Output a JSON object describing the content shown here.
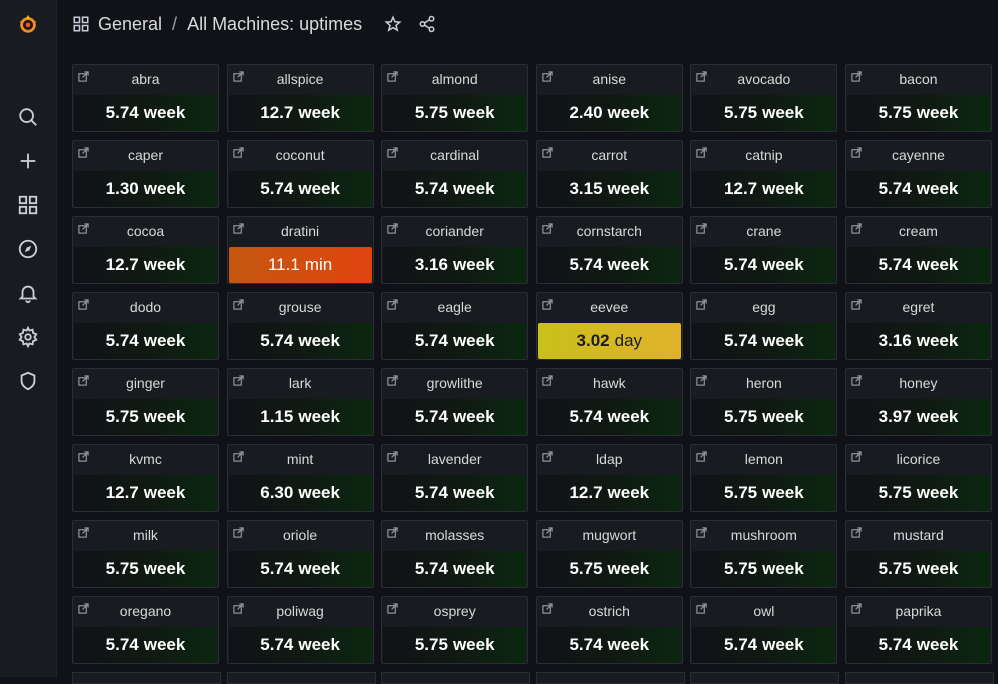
{
  "breadcrumb": {
    "folder": "General",
    "separator": "/",
    "dashboard": "All Machines: uptimes"
  },
  "colors": {
    "ok": "#0b2710",
    "warning": "#e0b22a",
    "critical": "#e0440e",
    "accent": "#f05a28"
  },
  "panels": [
    {
      "name": "abra",
      "value": "5.74",
      "unit": "week",
      "state": "ok"
    },
    {
      "name": "allspice",
      "value": "12.7",
      "unit": "week",
      "state": "ok"
    },
    {
      "name": "almond",
      "value": "5.75",
      "unit": "week",
      "state": "ok"
    },
    {
      "name": "anise",
      "value": "2.40",
      "unit": "week",
      "state": "ok"
    },
    {
      "name": "avocado",
      "value": "5.75",
      "unit": "week",
      "state": "ok"
    },
    {
      "name": "bacon",
      "value": "5.75",
      "unit": "week",
      "state": "ok"
    },
    {
      "name": "caper",
      "value": "1.30",
      "unit": "week",
      "state": "ok"
    },
    {
      "name": "coconut",
      "value": "5.74",
      "unit": "week",
      "state": "ok"
    },
    {
      "name": "cardinal",
      "value": "5.74",
      "unit": "week",
      "state": "ok"
    },
    {
      "name": "carrot",
      "value": "3.15",
      "unit": "week",
      "state": "ok"
    },
    {
      "name": "catnip",
      "value": "12.7",
      "unit": "week",
      "state": "ok"
    },
    {
      "name": "cayenne",
      "value": "5.74",
      "unit": "week",
      "state": "ok"
    },
    {
      "name": "cocoa",
      "value": "12.7",
      "unit": "week",
      "state": "ok"
    },
    {
      "name": "dratini",
      "value": "11.1",
      "unit": "min",
      "state": "critical"
    },
    {
      "name": "coriander",
      "value": "3.16",
      "unit": "week",
      "state": "ok"
    },
    {
      "name": "cornstarch",
      "value": "5.74",
      "unit": "week",
      "state": "ok"
    },
    {
      "name": "crane",
      "value": "5.74",
      "unit": "week",
      "state": "ok"
    },
    {
      "name": "cream",
      "value": "5.74",
      "unit": "week",
      "state": "ok"
    },
    {
      "name": "dodo",
      "value": "5.74",
      "unit": "week",
      "state": "ok"
    },
    {
      "name": "grouse",
      "value": "5.74",
      "unit": "week",
      "state": "ok"
    },
    {
      "name": "eagle",
      "value": "5.74",
      "unit": "week",
      "state": "ok"
    },
    {
      "name": "eevee",
      "value": "3.02",
      "unit": "day",
      "state": "warning"
    },
    {
      "name": "egg",
      "value": "5.74",
      "unit": "week",
      "state": "ok"
    },
    {
      "name": "egret",
      "value": "3.16",
      "unit": "week",
      "state": "ok"
    },
    {
      "name": "ginger",
      "value": "5.75",
      "unit": "week",
      "state": "ok"
    },
    {
      "name": "lark",
      "value": "1.15",
      "unit": "week",
      "state": "ok"
    },
    {
      "name": "growlithe",
      "value": "5.74",
      "unit": "week",
      "state": "ok"
    },
    {
      "name": "hawk",
      "value": "5.74",
      "unit": "week",
      "state": "ok"
    },
    {
      "name": "heron",
      "value": "5.75",
      "unit": "week",
      "state": "ok"
    },
    {
      "name": "honey",
      "value": "3.97",
      "unit": "week",
      "state": "ok"
    },
    {
      "name": "kvmc",
      "value": "12.7",
      "unit": "week",
      "state": "ok"
    },
    {
      "name": "mint",
      "value": "6.30",
      "unit": "week",
      "state": "ok"
    },
    {
      "name": "lavender",
      "value": "5.74",
      "unit": "week",
      "state": "ok"
    },
    {
      "name": "ldap",
      "value": "12.7",
      "unit": "week",
      "state": "ok"
    },
    {
      "name": "lemon",
      "value": "5.75",
      "unit": "week",
      "state": "ok"
    },
    {
      "name": "licorice",
      "value": "5.75",
      "unit": "week",
      "state": "ok"
    },
    {
      "name": "milk",
      "value": "5.75",
      "unit": "week",
      "state": "ok"
    },
    {
      "name": "oriole",
      "value": "5.74",
      "unit": "week",
      "state": "ok"
    },
    {
      "name": "molasses",
      "value": "5.74",
      "unit": "week",
      "state": "ok"
    },
    {
      "name": "mugwort",
      "value": "5.75",
      "unit": "week",
      "state": "ok"
    },
    {
      "name": "mushroom",
      "value": "5.75",
      "unit": "week",
      "state": "ok"
    },
    {
      "name": "mustard",
      "value": "5.75",
      "unit": "week",
      "state": "ok"
    },
    {
      "name": "oregano",
      "value": "5.74",
      "unit": "week",
      "state": "ok"
    },
    {
      "name": "poliwag",
      "value": "5.74",
      "unit": "week",
      "state": "ok"
    },
    {
      "name": "osprey",
      "value": "5.75",
      "unit": "week",
      "state": "ok"
    },
    {
      "name": "ostrich",
      "value": "5.74",
      "unit": "week",
      "state": "ok"
    },
    {
      "name": "owl",
      "value": "5.74",
      "unit": "week",
      "state": "ok"
    },
    {
      "name": "paprika",
      "value": "5.74",
      "unit": "week",
      "state": "ok"
    }
  ],
  "icons": {
    "logo": "grafana-logo-icon",
    "sidebar": [
      "search-icon",
      "plus-icon",
      "dashboards-icon",
      "explore-icon",
      "bell-icon",
      "gear-icon",
      "shield-icon"
    ],
    "topbar": [
      "star-icon",
      "share-icon"
    ],
    "panel_link": "external-link-icon"
  }
}
